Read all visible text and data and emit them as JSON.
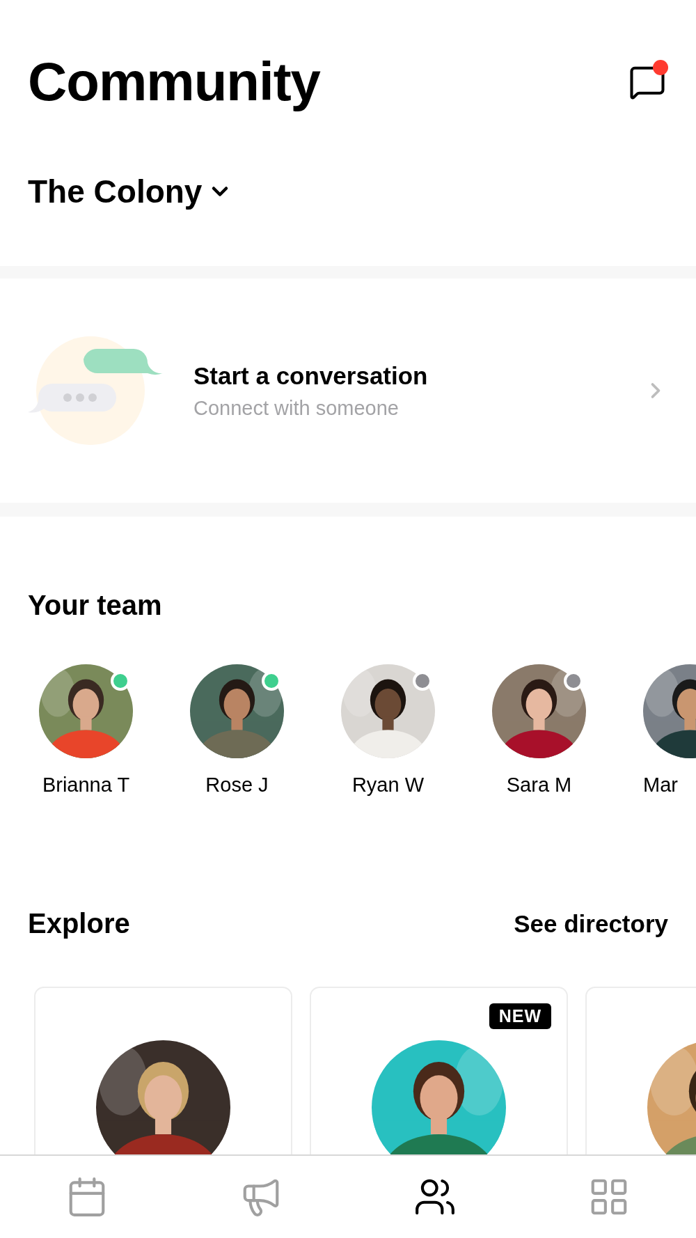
{
  "header": {
    "title": "Community",
    "messages_unread": true
  },
  "community": {
    "name": "The Colony"
  },
  "conversation": {
    "title": "Start a conversation",
    "subtitle": "Connect with someone"
  },
  "team": {
    "title": "Your team",
    "members": [
      {
        "name": "Brianna T",
        "online": true
      },
      {
        "name": "Rose J",
        "online": true
      },
      {
        "name": "Ryan W",
        "online": false
      },
      {
        "name": "Sara M",
        "online": false
      },
      {
        "name": "Mar"
      }
    ]
  },
  "explore": {
    "title": "Explore",
    "link": "See directory",
    "cards": [
      {
        "kind": "picture"
      },
      {
        "kind": "picture",
        "badge": "NEW"
      },
      {
        "kind": "picture"
      }
    ]
  },
  "tab_bar": [
    {
      "selected": false
    },
    {
      "selected": false
    },
    {
      "selected": true
    },
    {
      "selected": false
    }
  ]
}
